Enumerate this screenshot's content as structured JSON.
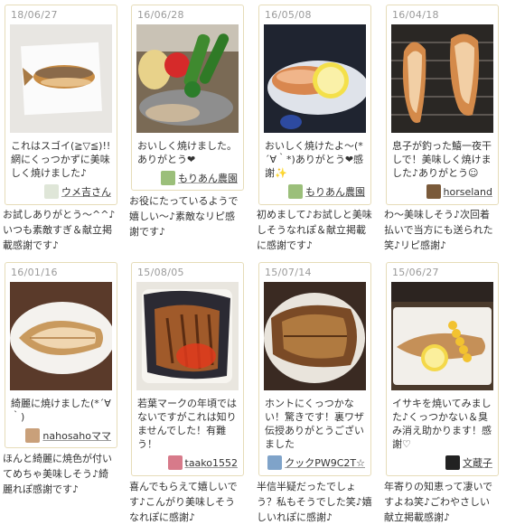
{
  "cards": [
    {
      "date": "18/06/27",
      "message": "これはスゴイ(≧▽≦)!! 網にくっつかずに美味しく焼けました♪",
      "author": "ウメ吉さん",
      "reply": "お試しありがとう～^^♪いつも素敵すぎ＆献立掲載感謝です♪"
    },
    {
      "date": "16/06/28",
      "message": "おいしく焼けました。ありがとう❤",
      "author": "もりあん農園",
      "reply": "お役にたっているようで嬉しい～♪素敵なリピ感謝です♪"
    },
    {
      "date": "16/05/08",
      "message": "おいしく焼けたよ～(*´∀｀*)ありがとう❤感謝✨",
      "author": "もりあん農園",
      "reply": "初めまして♪お試しと美味しそうなれぽ＆献立掲載に感謝です♪"
    },
    {
      "date": "16/04/18",
      "message": "息子が釣った鱚一夜干しで！美味しく焼けました♪ありがとう☺",
      "author": "horseland",
      "reply": "わ～美味しそう♪次回着払いで当方にも送られた笑♪リピ感謝♪"
    },
    {
      "date": "16/01/16",
      "message": "綺麗に焼けました(*´∀｀)",
      "author": "nahosahoママ",
      "reply": "ほんと綺麗に焼色が付いてめちゃ美味しそう♪綺麗れぽ感謝です♪"
    },
    {
      "date": "15/08/05",
      "message": "若葉マークの年頃ではないですがこれは知りませんでした！有難う！",
      "author": "taako1552",
      "reply": "喜んでもらえて嬉しいです♪こんがり美味しそうなれぽに感謝♪"
    },
    {
      "date": "15/07/14",
      "message": "ホントにくっつかない！驚きです！裏ワザ伝授ありがとうございました",
      "author": "クックPW9C2T☆",
      "reply": "半信半疑だったでしょう？私もそうでした笑♪嬉しいれぽに感謝♪"
    },
    {
      "date": "15/06/27",
      "message": "イサキを焼いてみました♪くっつかない＆臭み消え助かります！感謝♡",
      "author": "文蔵子",
      "reply": "年寄りの知恵って凄いですよね笑♪ごわやさしい献立掲載感謝♪"
    }
  ],
  "colors": {
    "card_border": "#e6dcb8",
    "date_text": "#9a9a9a"
  }
}
